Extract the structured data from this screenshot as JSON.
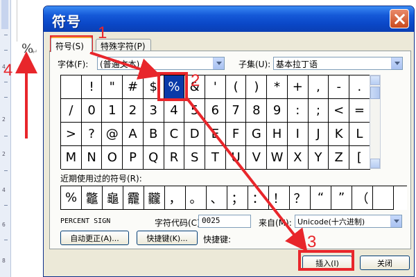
{
  "document": {
    "inserted_symbol": "%",
    "paragraph_mark": "↵",
    "ruler_numbers": [
      "4",
      "2",
      "2",
      "4",
      "6",
      "8"
    ]
  },
  "dialog": {
    "title": "符号",
    "tabs": [
      {
        "label": "符号(S)"
      },
      {
        "label": "特殊字符(P)"
      }
    ],
    "font_label": "字体(F):",
    "font_value": "(普通文本)",
    "subset_label": "子集(U):",
    "subset_value": "基本拉丁语",
    "symbols": [
      " ",
      "!",
      "\"",
      "#",
      "$",
      "%",
      "&",
      "'",
      "(",
      ")",
      "*",
      "+",
      ",",
      "-",
      ".",
      "/",
      "0",
      "1",
      "2",
      "3",
      "4",
      "5",
      "6",
      "7",
      "8",
      "9",
      ":",
      ";",
      "<",
      "=",
      ">",
      "?",
      "@",
      "A",
      "B",
      "C",
      "D",
      "E",
      "F",
      "G",
      "H",
      "I",
      "J",
      "K",
      "L",
      "M",
      "N",
      "O",
      "P",
      "Q",
      "R",
      "S",
      "T",
      "U",
      "V",
      "W",
      "X",
      "Y",
      "Z",
      "["
    ],
    "selected_symbol": "%",
    "recent_label": "近期使用过的符号(R):",
    "recent_symbols": [
      "%",
      "龞",
      "龜",
      "龗",
      "龖",
      "，",
      "。",
      "、",
      "；",
      "：",
      "！",
      "？",
      "“",
      "”",
      "（",
      ""
    ],
    "char_name": "PERCENT SIGN",
    "char_code_label": "字符代码(C):",
    "char_code_value": "0025",
    "from_label": "来自(M):",
    "from_value": "Unicode(十六进制)",
    "autocorrect_label": "自动更正(A)...",
    "shortcut_key_button_label": "快捷键(K)...",
    "shortcut_key_label": "快捷键:",
    "insert_label": "插入(I)",
    "close_label": "关闭"
  },
  "annotations": {
    "step_1": "1",
    "step_2": "2",
    "step_3": "3",
    "step_4": "4",
    "color": "#e8262b"
  },
  "colors": {
    "titlebar": "#0a47c7",
    "dialog_bg": "#ece9d8",
    "selection": "#0a3aa8"
  }
}
